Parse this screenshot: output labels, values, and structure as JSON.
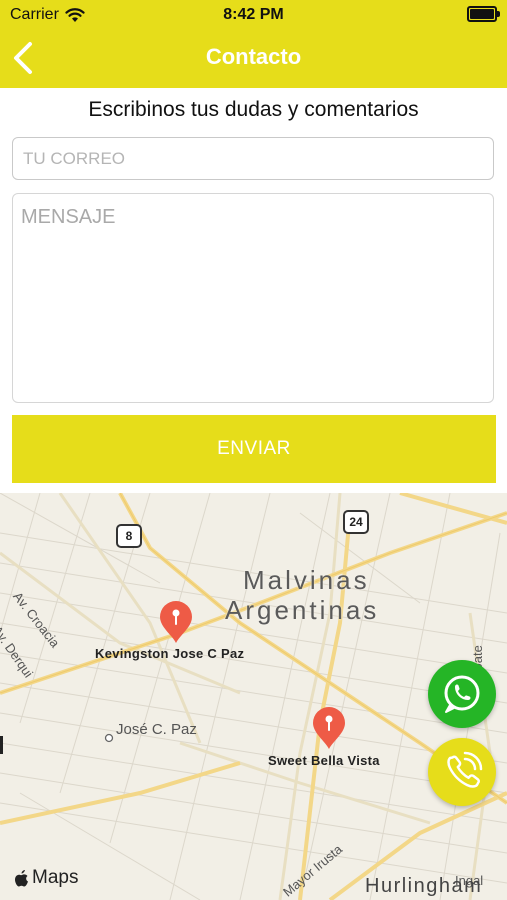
{
  "status_bar": {
    "carrier": "Carrier",
    "time": "8:42 PM"
  },
  "nav": {
    "title": "Contacto"
  },
  "form": {
    "heading": "Escribinos tus dudas y comentarios",
    "email_placeholder": "TU CORREO",
    "message_placeholder": "MENSAJE",
    "send_label": "ENVIAR"
  },
  "map": {
    "city_name_line1": "Malvinas",
    "city_name_line2": "Argentinas",
    "town_label": "José C. Paz",
    "town_label_2": "Hurlingham",
    "street_croacia": "Av. Croacia",
    "street_derqui": "Av. Derqui",
    "street_idoate": "Ido Idoate",
    "street_irusta": "Mayor Irusta",
    "street_partial": "Ingal",
    "route_8": "8",
    "route_24": "24",
    "pins": [
      {
        "label": "Kevingston Jose C Paz"
      },
      {
        "label": "Sweet Bella Vista"
      }
    ],
    "attribution": "Maps"
  },
  "colors": {
    "brand_yellow": "#e6dd1a",
    "whatsapp_green": "#25b526",
    "pin_red": "#ee5b46"
  }
}
